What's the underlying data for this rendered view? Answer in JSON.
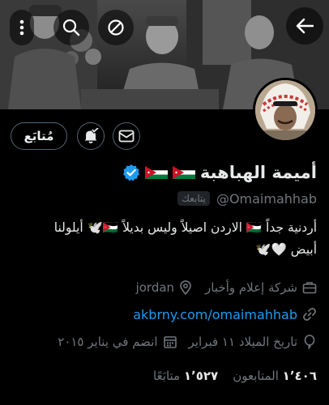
{
  "header": {
    "back_icon": "arrow-left-icon",
    "block_icon": "block-icon",
    "search_icon": "search-icon",
    "more_icon": "more-vertical-icon"
  },
  "profile": {
    "name": "أميمة الهباهبة",
    "flags": "🇯🇴🇯🇴",
    "verified": true,
    "handle": "@Omaimahhab",
    "follows_you": "يتابعك",
    "bio_line1": "أردنية جداً 🇯🇴 الاردن اصيلاً وليس بديلاً 🇯🇴🕊️ أيلولنا",
    "bio_line2": "أبيض 🤍🕊️",
    "category": "شركة إعلام وأخبار",
    "location": "jordan",
    "website": "akbrny.com/omaimahhab",
    "birthday": "تاريخ الميلاد ١١ فبراير",
    "joined": "انضم في يناير ٢٠١٥",
    "following_count": "١٬٥٢٧",
    "following_label": "متابَعًا",
    "followers_count": "١٬٤٠٦",
    "followers_label": "المتابعون"
  },
  "actions": {
    "follow_label": "مُتابَع",
    "notify_icon": "bell-check-icon",
    "message_icon": "mail-icon"
  },
  "colors": {
    "accent": "#1d9bf0",
    "muted": "#71767b",
    "background": "#000000"
  }
}
